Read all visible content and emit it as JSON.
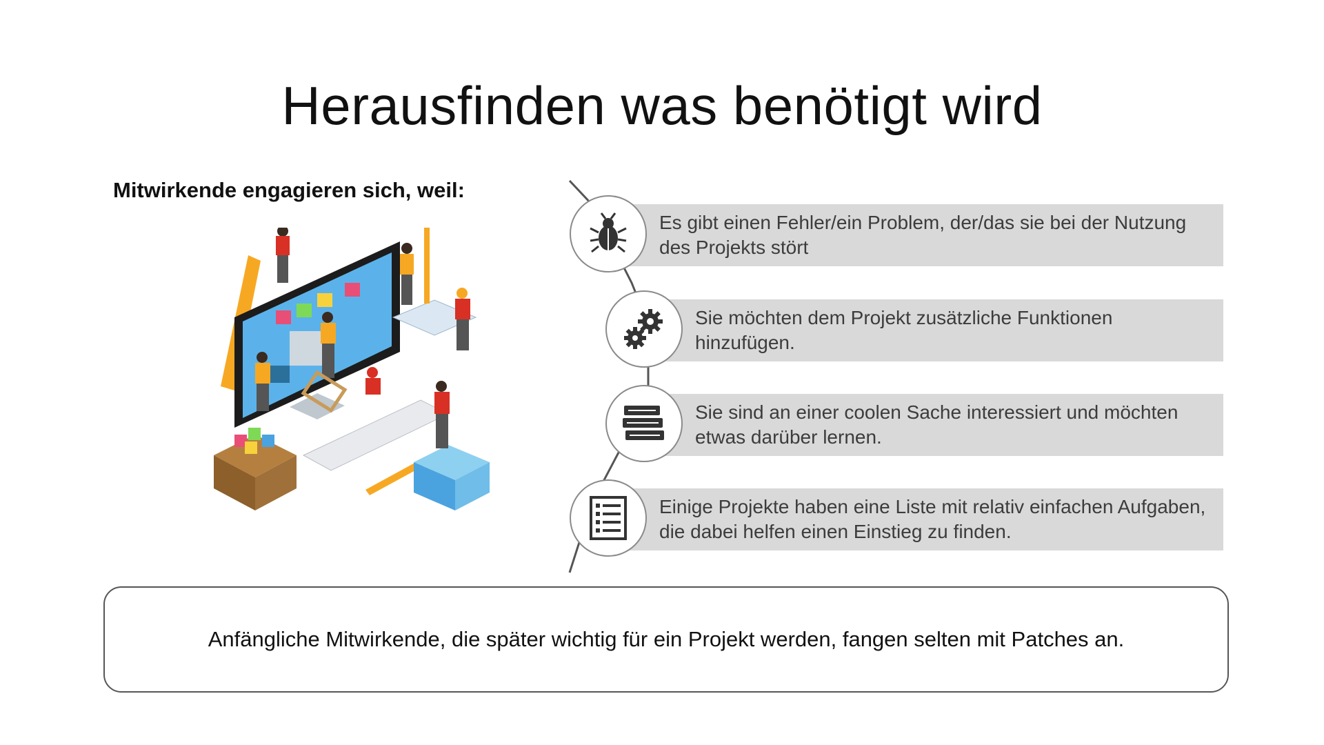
{
  "slide": {
    "title": "Herausfinden was benötigt wird",
    "subheading": "Mitwirkende engagieren sich, weil:"
  },
  "reasons": [
    {
      "icon": "bug-icon",
      "text": "Es gibt einen Fehler/ein Problem, der/das sie bei der Nutzung des Projekts stört"
    },
    {
      "icon": "gears-icon",
      "text": "Sie möchten dem Projekt zusätzliche Funktionen hinzufügen."
    },
    {
      "icon": "books-icon",
      "text": "Sie sind an einer coolen Sache interessiert und möchten etwas darüber lernen."
    },
    {
      "icon": "checklist-icon",
      "text": "Einige Projekte haben eine Liste mit relativ einfachen Aufgaben, die dabei helfen einen Einstieg zu finden."
    }
  ],
  "footer": {
    "text": "Anfängliche Mitwirkende, die später wichtig für ein Projekt werden, fangen selten mit Patches an."
  },
  "colors": {
    "box_background": "#d9d9d9",
    "timeline_line": "#555555",
    "accent_orange": "#f7a823",
    "accent_red": "#d93025",
    "screen_blue": "#4aa3df"
  }
}
